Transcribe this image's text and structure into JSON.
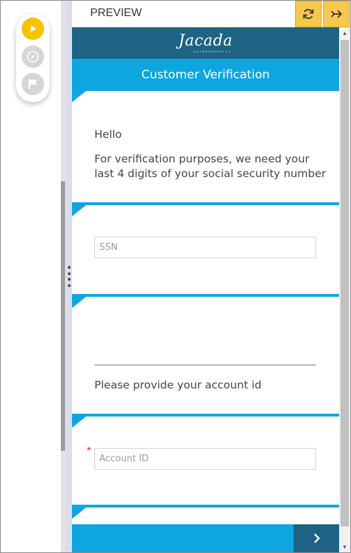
{
  "header": {
    "preview_label": "PREVIEW"
  },
  "toolbar": {
    "icons": [
      "play-icon",
      "compass-icon",
      "flag-icon"
    ],
    "refresh_icon": "refresh-icon",
    "forward_icon": "double-arrow-right-icon"
  },
  "brand": {
    "logo_text": "Jacada",
    "logo_tagline": "AUTONOMOUS CX"
  },
  "form": {
    "title": "Customer Verification",
    "greeting": "Hello",
    "message_line1": "For verification purposes, we need your",
    "message_line2": "last 4 digits of your social security number",
    "ssn_placeholder": "SSN",
    "account_prompt": "Please provide your account id",
    "account_placeholder": "Account ID",
    "required_marker": "*"
  },
  "colors": {
    "accent": "#0da6e0",
    "brand": "#1d6383",
    "toolbar_yellow": "#f6c84e",
    "play_active": "#f7c300"
  }
}
